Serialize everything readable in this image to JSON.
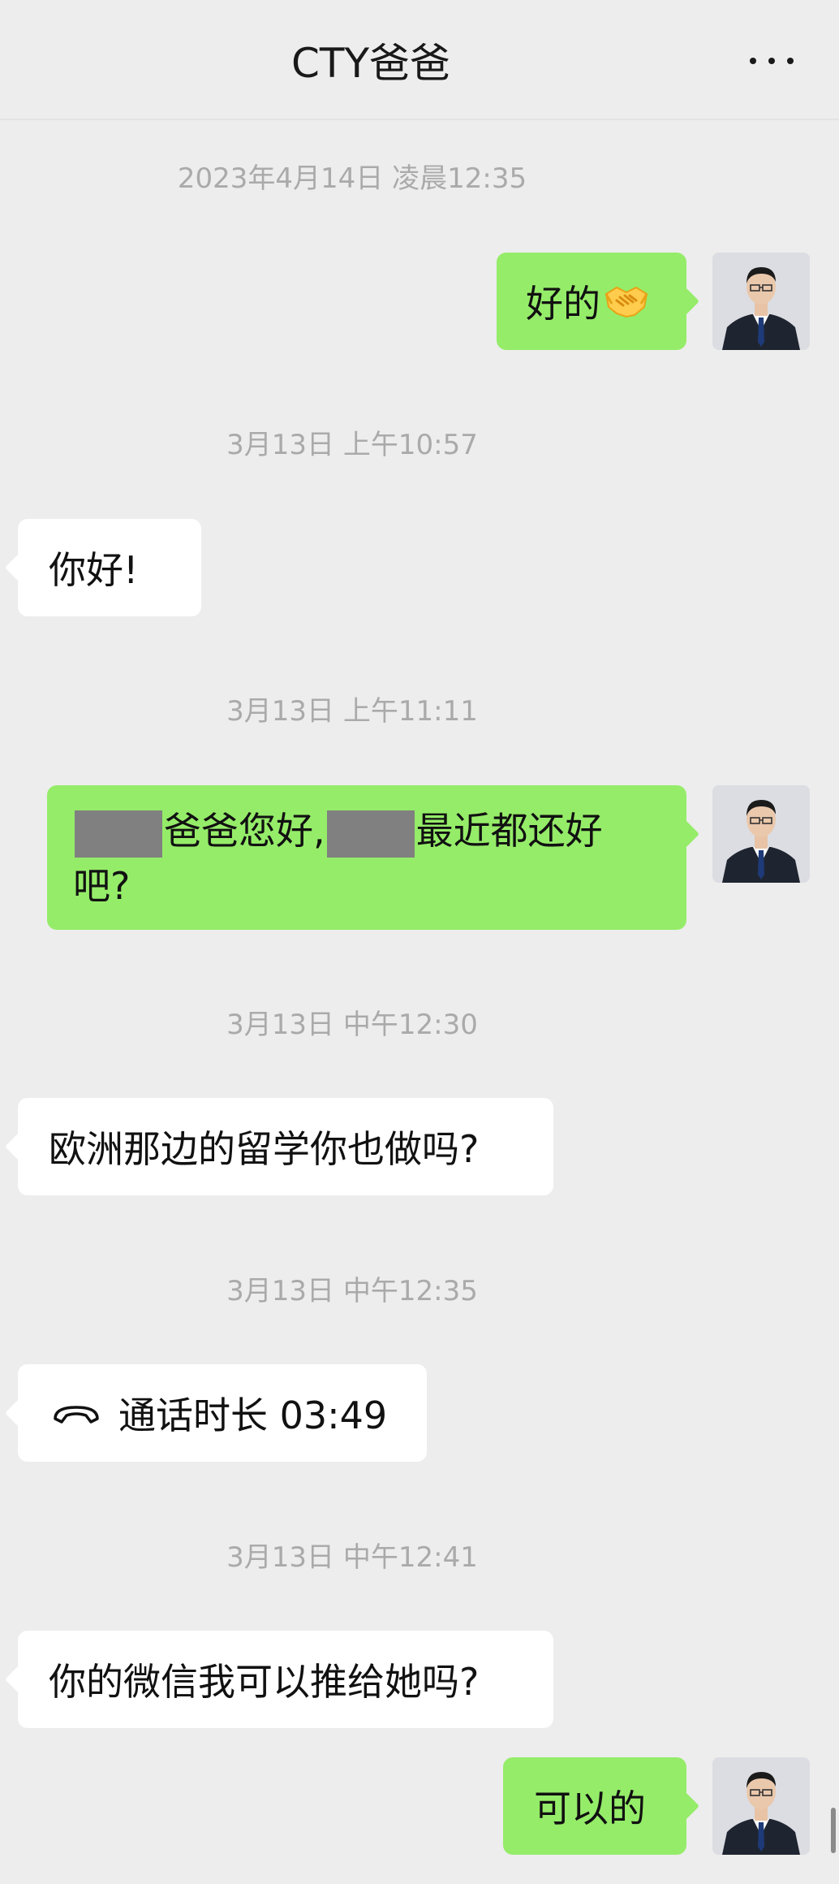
{
  "header": {
    "title": "CTY爸爸",
    "more_icon": "more-dots-icon"
  },
  "colors": {
    "background": "#ededed",
    "incoming_bubble": "#ffffff",
    "outgoing_bubble": "#95ec69",
    "timestamp": "#aaaaaa"
  },
  "messages": [
    {
      "kind": "time",
      "text": "2023年4月14日 凌晨12:35"
    },
    {
      "kind": "out",
      "text": "好的",
      "emoji": "handshake-emoji"
    },
    {
      "kind": "time",
      "text": "3月13日 上午10:57"
    },
    {
      "kind": "in",
      "text": "你好!"
    },
    {
      "kind": "time",
      "text": "3月13日 上午11:11"
    },
    {
      "kind": "out",
      "text_a": "爸爸您好,",
      "text_b": "最近都还好",
      "text_c": "吧?"
    },
    {
      "kind": "time",
      "text": "3月13日 中午12:30"
    },
    {
      "kind": "in",
      "text": "欧洲那边的留学你也做吗?"
    },
    {
      "kind": "time",
      "text": "3月13日 中午12:35"
    },
    {
      "kind": "in-call",
      "icon": "phone-hangup-icon",
      "text": "通话时长 03:49"
    },
    {
      "kind": "time",
      "text": "3月13日 中午12:41"
    },
    {
      "kind": "in",
      "text": "你的微信我可以推给她吗?"
    },
    {
      "kind": "out",
      "text": "可以的"
    }
  ]
}
